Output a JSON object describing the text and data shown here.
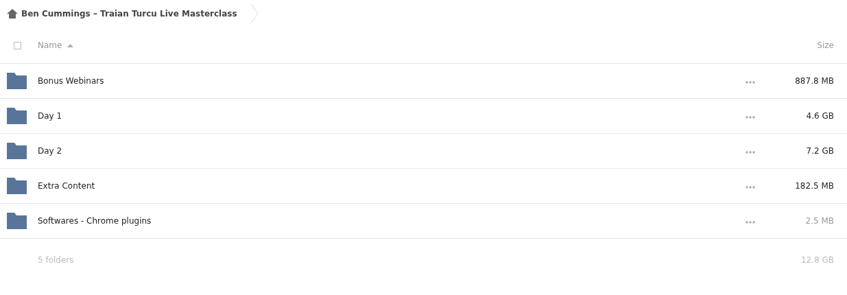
{
  "breadcrumb": {
    "title": "Ben Cummings – Traian Turcu Live Masterclass"
  },
  "table": {
    "select_all": {
      "checked": false
    },
    "columns": [
      {
        "label": "Name",
        "sorted": true
      },
      {
        "label": "Size",
        "sorted": false
      }
    ],
    "rows": [
      {
        "name": "Bonus Webinars",
        "size": "887.8 MB",
        "dimmed": false
      },
      {
        "name": "Day 1",
        "size": "4.6 GB",
        "dimmed": false
      },
      {
        "name": "Day 2",
        "size": "7.2 GB",
        "dimmed": false
      },
      {
        "name": "Extra Content",
        "size": "182.5 MB",
        "dimmed": false
      },
      {
        "name": "Softwares - Chrome plugins",
        "size": "2.5 MB",
        "dimmed": true
      }
    ]
  },
  "summary": {
    "count": "5 folders",
    "total": "12.8 GB"
  }
}
